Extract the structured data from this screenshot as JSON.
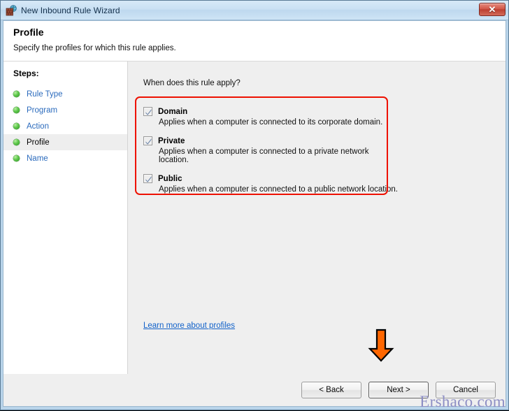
{
  "window": {
    "title": "New Inbound Rule Wizard",
    "icon": "firewall-globe-icon",
    "close_label": "✖"
  },
  "header": {
    "title": "Profile",
    "subtitle": "Specify the profiles for which this rule applies."
  },
  "sidebar": {
    "heading": "Steps:",
    "items": [
      {
        "label": "Rule Type",
        "current": false
      },
      {
        "label": "Program",
        "current": false
      },
      {
        "label": "Action",
        "current": false
      },
      {
        "label": "Profile",
        "current": true
      },
      {
        "label": "Name",
        "current": false
      }
    ]
  },
  "main": {
    "question": "When does this rule apply?",
    "profiles": [
      {
        "label": "Domain",
        "description": "Applies when a computer is connected to its corporate domain.",
        "checked": true
      },
      {
        "label": "Private",
        "description": "Applies when a computer is connected to a private network location.",
        "checked": true
      },
      {
        "label": "Public",
        "description": "Applies when a computer is connected to a public network location.",
        "checked": true
      }
    ],
    "learn_more_link": "Learn more about profiles"
  },
  "footer": {
    "back_label": "< Back",
    "next_label": "Next >",
    "cancel_label": "Cancel"
  },
  "annotations": {
    "rect_color": "#ee1100",
    "arrow_color": "#ff6600",
    "arrow_points_to": "Next >"
  },
  "watermark": {
    "text": "Ershaco.com"
  },
  "colors": {
    "titlebar": "#c9e0f3",
    "window_border": "#b9d4ea",
    "sidebar_bg": "#ffffff",
    "main_bg": "#efefef",
    "link": "#1161c9",
    "step_link": "#2b6bbd",
    "bullet_green": "#5ec84b",
    "close_red": "#bc3f30"
  }
}
